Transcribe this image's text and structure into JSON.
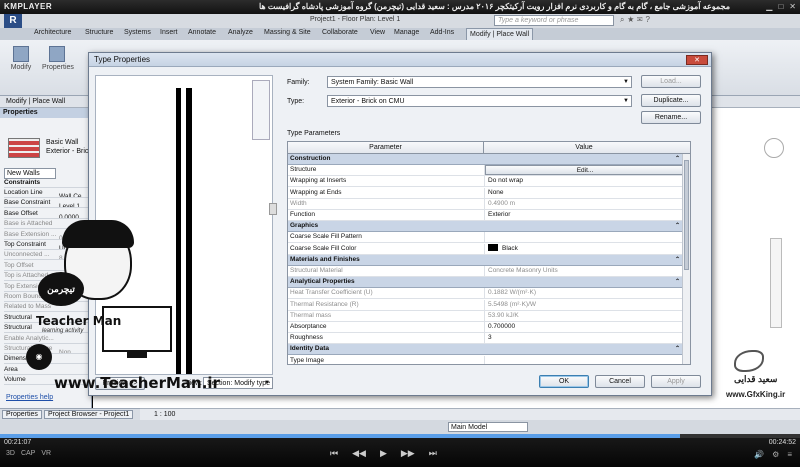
{
  "player": {
    "logo": "KMPLAYER",
    "title": "مجموعه آموزشی جامع ، گام به گام و کاربردی نرم افزار رویت آرکیتکچر ۲۰۱۶  مدرس : سعید قدایی (تیچرمن) گروه آموزشی پادشاه گرافیست ها",
    "time_elapsed": "00:21:07",
    "time_total": "00:24:52",
    "progress": 0.85,
    "controls_left": [
      "3D",
      "CAP",
      "VR"
    ],
    "controls_center": [
      "⏮",
      "◀◀",
      "▶",
      "▶▶",
      "⏭"
    ],
    "controls_right": [
      "🔊",
      "⚙",
      "≡"
    ]
  },
  "revit": {
    "doc_title": "Project1 - Floor Plan: Level 1",
    "search_placeholder": "Type a keyword or phrase",
    "tabs": [
      "Architecture",
      "Structure",
      "Systems",
      "Insert",
      "Annotate",
      "Analyze",
      "Massing & Site",
      "Collaborate",
      "View",
      "Manage",
      "Add-Ins",
      "Modify | Place Wall"
    ],
    "active_tab": "Modify | Place Wall",
    "ribbon_buttons": [
      "Modify",
      "Properties"
    ],
    "context_label": "Modify | Place Wall"
  },
  "properties": {
    "header": "Properties",
    "type_name_1": "Basic Wall",
    "type_name_2": "Exterior - Brick",
    "selector": "New Walls",
    "section": "Constraints",
    "rows": [
      {
        "k": "Location Line",
        "v": "Wall Ce"
      },
      {
        "k": "Base Constraint",
        "v": "Level 1"
      },
      {
        "k": "Base Offset",
        "v": "0.0000"
      },
      {
        "k": "Base is Attached",
        "v": ""
      },
      {
        "k": "Base Extension ...",
        "v": "0.0000"
      },
      {
        "k": "Top Constraint",
        "v": "Unconne"
      },
      {
        "k": "Unconnected ...",
        "v": "8.0000"
      },
      {
        "k": "Top Offset",
        "v": ""
      },
      {
        "k": "Top is Attached",
        "v": ""
      },
      {
        "k": "Top Extension",
        "v": ""
      },
      {
        "k": "Room Bounding",
        "v": ""
      },
      {
        "k": "Related to Mass",
        "v": ""
      },
      {
        "k": "Structural",
        "v": ""
      },
      {
        "k": "Structural",
        "v": ""
      },
      {
        "k": "Enable Analytic...",
        "v": ""
      },
      {
        "k": "Structural Usage",
        "v": "Non"
      },
      {
        "k": "Dimensions",
        "v": ""
      },
      {
        "k": "Area",
        "v": ""
      },
      {
        "k": "Volume",
        "v": ""
      }
    ],
    "help": "Properties help",
    "apply": "Apply"
  },
  "browser_tabs": [
    "Properties",
    "Project Browser - Project1"
  ],
  "view_control": {
    "scale": "1 : 100"
  },
  "status": {
    "model": "Main Model"
  },
  "dialog": {
    "title": "Type Properties",
    "close": "✕",
    "family_label": "Family:",
    "family_value": "System Family: Basic Wall",
    "type_label": "Type:",
    "type_value": "Exterior - Brick on CMU",
    "load": "Load...",
    "duplicate": "Duplicate...",
    "rename": "Rename...",
    "type_params": "Type Parameters",
    "col_param": "Parameter",
    "col_value": "Value",
    "rows": [
      {
        "kind": "group",
        "p": "Construction",
        "v": ""
      },
      {
        "kind": "edit",
        "p": "Structure",
        "v": "Edit..."
      },
      {
        "kind": "row",
        "p": "Wrapping at Inserts",
        "v": "Do not wrap"
      },
      {
        "kind": "row",
        "p": "Wrapping at Ends",
        "v": "None"
      },
      {
        "kind": "grey",
        "p": "Width",
        "v": "0.4900 m"
      },
      {
        "kind": "row",
        "p": "Function",
        "v": "Exterior"
      },
      {
        "kind": "group",
        "p": "Graphics",
        "v": ""
      },
      {
        "kind": "row",
        "p": "Coarse Scale Fill Pattern",
        "v": ""
      },
      {
        "kind": "swatch",
        "p": "Coarse Scale Fill Color",
        "v": "Black"
      },
      {
        "kind": "group",
        "p": "Materials and Finishes",
        "v": ""
      },
      {
        "kind": "grey",
        "p": "Structural Material",
        "v": "Concrete Masonry Units"
      },
      {
        "kind": "group",
        "p": "Analytical Properties",
        "v": ""
      },
      {
        "kind": "grey",
        "p": "Heat Transfer Coefficient (U)",
        "v": "0.1882 W/(m²·K)"
      },
      {
        "kind": "grey",
        "p": "Thermal Resistance (R)",
        "v": "5.5498 (m²·K)/W"
      },
      {
        "kind": "grey",
        "p": "Thermal mass",
        "v": "53.90 kJ/K"
      },
      {
        "kind": "row",
        "p": "Absorptance",
        "v": "0.700000"
      },
      {
        "kind": "row",
        "p": "Roughness",
        "v": "3"
      },
      {
        "kind": "group",
        "p": "Identity Data",
        "v": ""
      },
      {
        "kind": "row",
        "p": "Type Image",
        "v": ""
      }
    ],
    "preview_btn": "Preview >>",
    "view_label": "View:",
    "view_value": "Section: Modify type",
    "ok": "OK",
    "cancel": "Cancel",
    "apply": "Apply"
  },
  "watermark": {
    "badge": "تیچرمن",
    "name": "Teacher Man",
    "sub": "learning activity",
    "url": "www.TeacherMan.ir",
    "right_name": "سعید قدایی",
    "right_url": "www.GfxKing.ir"
  }
}
